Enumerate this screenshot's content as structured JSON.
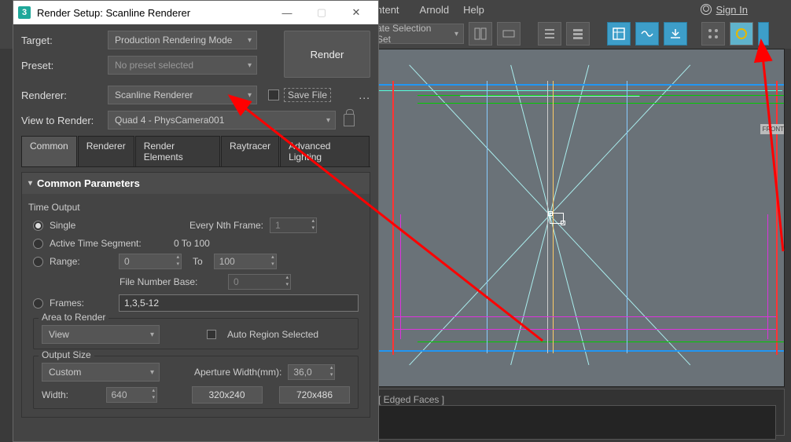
{
  "topmenu": {
    "content": "Content",
    "arnold": "Arnold",
    "help": "Help",
    "signin": "Sign In"
  },
  "toolbar": {
    "selection_set": "ate Selection Set"
  },
  "viewport": {
    "front_label": "FRONT"
  },
  "timeline": {
    "label": "[ Edged Faces ]"
  },
  "dialog": {
    "title": "Render Setup: Scanline Renderer",
    "target_label": "Target:",
    "target_value": "Production Rendering Mode",
    "preset_label": "Preset:",
    "preset_value": "No preset selected",
    "renderer_label": "Renderer:",
    "renderer_value": "Scanline Renderer",
    "save_file": "Save File",
    "dots": "...",
    "view_label": "View to Render:",
    "view_value": "Quad 4 - PhysCamera001",
    "render_btn": "Render",
    "tabs": {
      "common": "Common",
      "renderer": "Renderer",
      "elements": "Render Elements",
      "raytracer": "Raytracer",
      "lighting": "Advanced Lighting"
    },
    "rollout_title": "Common Parameters",
    "time_output": "Time Output",
    "single": "Single",
    "every_nth": "Every Nth Frame:",
    "nth_val": "1",
    "active_segment": "Active Time Segment:",
    "active_range": "0 To 100",
    "range": "Range:",
    "range_from": "0",
    "range_to_label": "To",
    "range_to": "100",
    "file_num_base": "File Number Base:",
    "file_num_val": "0",
    "frames": "Frames:",
    "frames_val": "1,3,5-12",
    "area_title": "Area to Render",
    "area_value": "View",
    "auto_region": "Auto Region Selected",
    "output_title": "Output Size",
    "output_mode": "Custom",
    "aperture_label": "Aperture Width(mm):",
    "aperture_val": "36,0",
    "width_label": "Width:",
    "width_val": "640",
    "preset_320": "320x240",
    "preset_720": "720x486"
  }
}
